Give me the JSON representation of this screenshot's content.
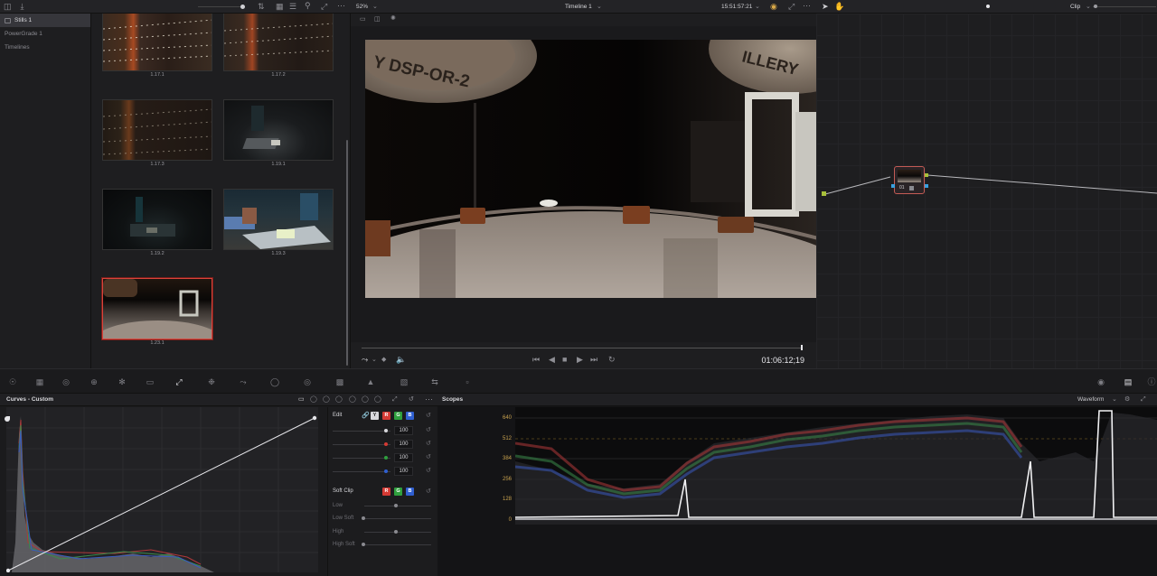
{
  "album": {
    "items": [
      {
        "label": "Stills 1",
        "active": true
      },
      {
        "label": "PowerGrade 1",
        "active": false
      },
      {
        "label": "Timelines",
        "active": false
      }
    ]
  },
  "gallery": {
    "stills": [
      {
        "label": "1.17.1"
      },
      {
        "label": "1.17.2"
      },
      {
        "label": "1.17.3"
      },
      {
        "label": "1.19.1"
      },
      {
        "label": "1.19.2"
      },
      {
        "label": "1.19.3"
      },
      {
        "label": "1.23.1",
        "selected": true
      }
    ]
  },
  "viewer": {
    "zoom": "52%",
    "timeline_name": "Timeline 1",
    "source_timecode": "15:51:57:21",
    "record_timecode": "01:06:12;19",
    "frame_text": [
      "Y DSP-OR-2",
      "ILLERY"
    ]
  },
  "nodes": {
    "mode": "Clip",
    "node_label": "01"
  },
  "curves": {
    "title": "Curves - Custom",
    "edit_label": "Edit",
    "channel_buttons": [
      "Y",
      "R",
      "G",
      "B"
    ],
    "intensity_values": [
      "100",
      "100",
      "100",
      "100"
    ],
    "soft_clip_label": "Soft Clip",
    "soft_clip_buttons": [
      "R",
      "G",
      "B"
    ],
    "soft_clip_rows": [
      "Low",
      "Low Soft",
      "High",
      "High Soft"
    ]
  },
  "scopes": {
    "title": "Scopes",
    "mode": "Waveform",
    "scale": [
      "640",
      "512",
      "384",
      "256",
      "128",
      "0"
    ]
  },
  "colors": {
    "accent_red": "#d8443c",
    "scale_gold": "#c9a24e",
    "panel_bg": "#1e1e20"
  }
}
